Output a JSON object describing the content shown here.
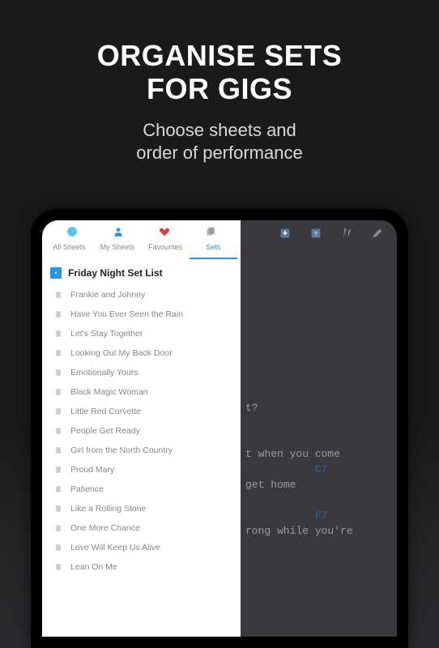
{
  "promo": {
    "title_line1": "ORGANISE SETS",
    "title_line2": "FOR GIGS",
    "subtitle_line1": "Choose sheets and",
    "subtitle_line2": "order of performance"
  },
  "tabs": {
    "items": [
      {
        "label": "All Sheets",
        "icon": "globe-icon"
      },
      {
        "label": "My Sheets",
        "icon": "user-icon"
      },
      {
        "label": "Favourites",
        "icon": "heart-icon"
      },
      {
        "label": "Sets",
        "icon": "sets-icon"
      }
    ],
    "active_index": 3
  },
  "set": {
    "title": "Friday Night Set List",
    "songs": [
      "Frankie and Johnny",
      "Have You Ever Seen the Rain",
      "Let's Stay Together",
      "Looking Out My Back Door",
      "Emotionally Yours",
      "Black Magic Woman",
      "Little Red Corvette",
      "People Get Ready",
      "Girl from the North Country",
      "Proud Mary",
      "Patience",
      "Like a Rolling Stone",
      "One More Chance",
      "Love Will Keep Us Alive",
      "Lean On Me"
    ]
  },
  "sheet_preview": {
    "lines": [
      {
        "text": "t?",
        "chord": ""
      },
      {
        "text": "",
        "chord": ""
      },
      {
        "text": "t when you come",
        "chord": ""
      },
      {
        "text": "",
        "chord": "C7"
      },
      {
        "text": " get home",
        "chord": ""
      },
      {
        "text": "",
        "chord": ""
      },
      {
        "text": "",
        "chord": "F7"
      },
      {
        "text": "rong while you're",
        "chord": ""
      }
    ]
  }
}
